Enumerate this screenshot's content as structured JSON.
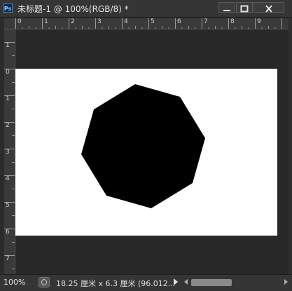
{
  "window": {
    "title": "未标题-1 @ 100%(RGB/8) *",
    "app_icon_label": "Ps",
    "buttons": {
      "minimize": "minimize-icon",
      "maximize": "maximize-icon",
      "close": "close-icon"
    }
  },
  "ruler": {
    "horizontal": [
      "0",
      "1",
      "2",
      "3",
      "4",
      "5",
      "6",
      "7",
      "8",
      "9"
    ],
    "vertical": [
      "1",
      "0",
      "1",
      "2",
      "3",
      "4",
      "5",
      "6",
      "7"
    ]
  },
  "document": {
    "background_color": "#ffffff",
    "shape": {
      "kind": "octagon",
      "fill": "#000000"
    }
  },
  "status": {
    "zoom": "100%",
    "doc_info": "18.25 厘米 x 6.3 厘米 (96.012..."
  },
  "colors": {
    "chrome": "#353535",
    "canvas_bg": "#282828",
    "ruler": "#3a3a3a"
  }
}
